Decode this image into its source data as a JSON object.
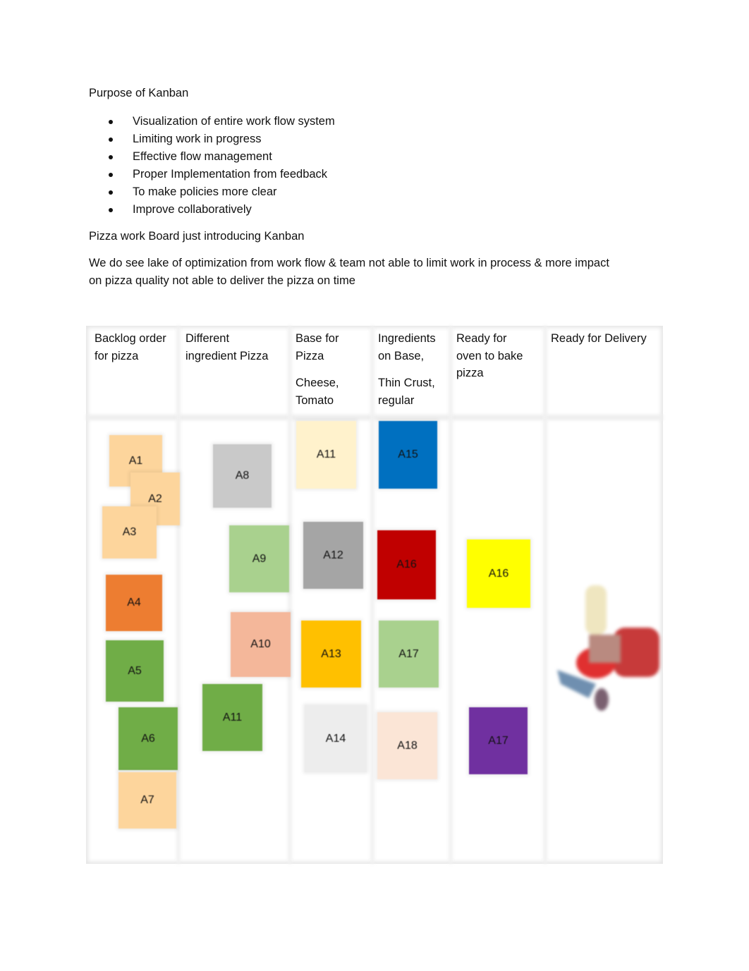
{
  "heading": "Purpose of Kanban",
  "bullets": [
    "Visualization of entire work flow system",
    "Limiting work in progress",
    "Effective flow management",
    "Proper Implementation from feedback",
    "To make policies more clear",
    "Improve collaboratively"
  ],
  "subheading": "Pizza work Board just introducing Kanban",
  "paragraph_line1": "We do see lake of optimization from work flow & team not able to limit work in process & more impact",
  "paragraph_line2": "on pizza quality not able to deliver the pizza on time",
  "columns": [
    {
      "l1": "Backlog order",
      "l2": "for pizza"
    },
    {
      "l1": "Different",
      "l2": "ingredient Pizza"
    },
    {
      "l1": "Base for",
      "l2": "Pizza",
      "l3": "Cheese,",
      "l4": "Tomato"
    },
    {
      "l1": "Ingredients",
      "l2": "on Base,",
      "l3": "Thin Crust,",
      "l4": "regular"
    },
    {
      "l1": "Ready for",
      "l2": "oven to bake",
      "l3": "pizza"
    },
    {
      "l1": "Ready for Delivery"
    }
  ],
  "cards": [
    {
      "label": "A1",
      "color": "#fdd59c"
    },
    {
      "label": "A2",
      "color": "#fdd59c"
    },
    {
      "label": "A3",
      "color": "#fdd59c"
    },
    {
      "label": "A4",
      "color": "#ed7d31"
    },
    {
      "label": "A5",
      "color": "#70ad47"
    },
    {
      "label": "A6",
      "color": "#70ad47"
    },
    {
      "label": "A7",
      "color": "#fdd59c"
    },
    {
      "label": "A8",
      "color": "#c9c9c9"
    },
    {
      "label": "A9",
      "color": "#a9d18e"
    },
    {
      "label": "A10",
      "color": "#f4b79a"
    },
    {
      "label": "A11",
      "color": "#70ad47"
    },
    {
      "label": "A11",
      "color": "#fff2cc"
    },
    {
      "label": "A12",
      "color": "#a5a5a5"
    },
    {
      "label": "A13",
      "color": "#ffc000"
    },
    {
      "label": "A14",
      "color": "#ededed"
    },
    {
      "label": "A15",
      "color": "#0070c0"
    },
    {
      "label": "A16",
      "color": "#c00000"
    },
    {
      "label": "A17",
      "color": "#a9d18e"
    },
    {
      "label": "A18",
      "color": "#fbe5d6"
    },
    {
      "label": "A16",
      "color": "#ffff00"
    },
    {
      "label": "A17",
      "color": "#7030a0"
    }
  ],
  "delivery_image": "delivery-scooter-icon"
}
